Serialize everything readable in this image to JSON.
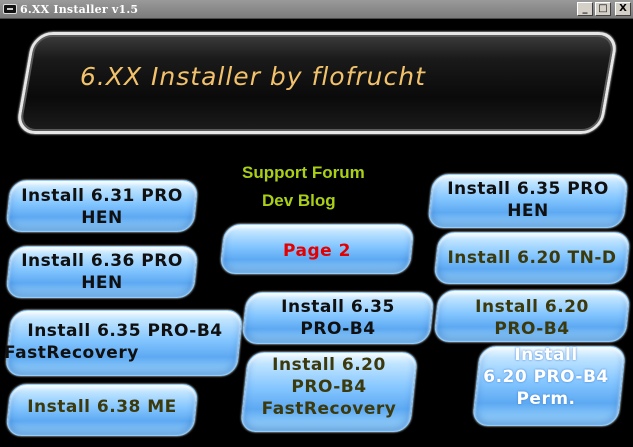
{
  "window": {
    "title": "6.XX Installer v1.5",
    "minimize": "_",
    "maximize": "□",
    "close": "X"
  },
  "banner": {
    "title": "6.XX Installer by flofrucht"
  },
  "links": {
    "support_forum": "Support Forum",
    "dev_blog": "Dev Blog"
  },
  "buttons": {
    "b631pro_hen": {
      "line1": "Install 6.31 PRO",
      "line2": "HEN"
    },
    "b636pro_hen": {
      "line1": "Install 6.36 PRO",
      "line2": "HEN"
    },
    "b635pro_b4_fr": {
      "line1": "Install 6.35 PRO-B4",
      "line2": "FastRecovery"
    },
    "b638me": {
      "line1": "Install 6.38 ME"
    },
    "page2": {
      "line1": "Page 2"
    },
    "b635pro_b4": {
      "line1": "Install 6.35",
      "line2": "PRO-B4"
    },
    "b620pro_b4_fr": {
      "line1": "Install 6.20",
      "line2": "PRO-B4",
      "line3": "FastRecovery"
    },
    "b635pro_hen": {
      "line1": "Install 6.35 PRO",
      "line2": "HEN"
    },
    "b620tnd": {
      "line1": "Install 6.20 TN-D"
    },
    "b620pro_b4": {
      "line1": "Install 6.20",
      "line2": "PRO-B4"
    },
    "b620pro_b4_perm": {
      "line1": "Install",
      "line2": "6.20 PRO-B4",
      "line3": "Perm."
    }
  }
}
